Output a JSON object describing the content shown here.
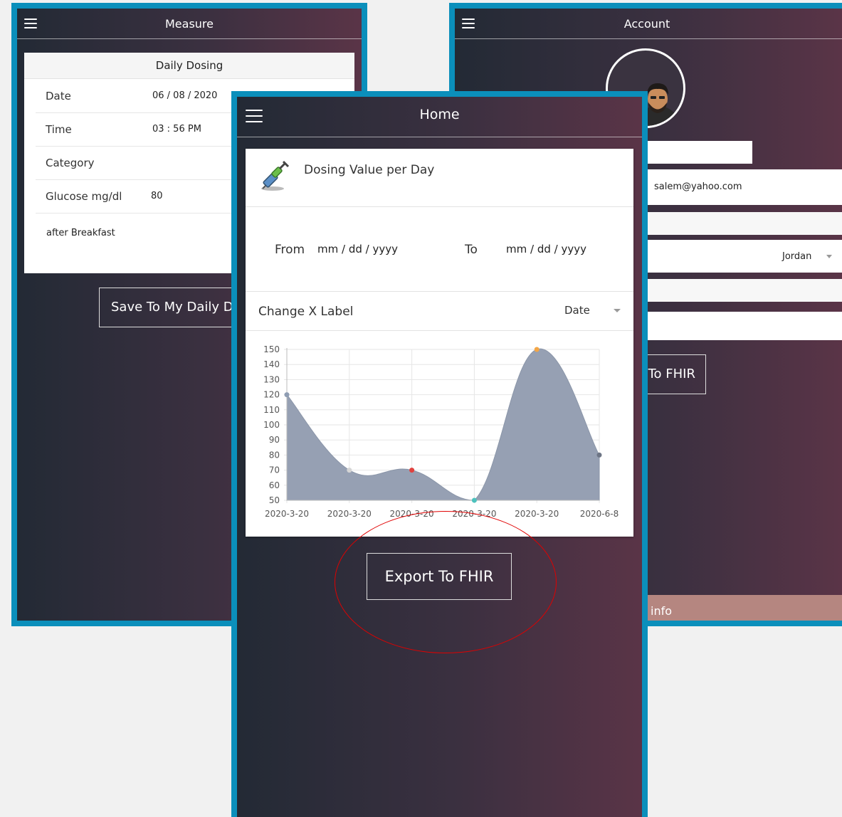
{
  "measure": {
    "title": "Measure",
    "card_title": "Daily Dosing",
    "rows": [
      {
        "label": "Date",
        "value": "06 / 08 / 2020"
      },
      {
        "label": "Time",
        "value": "03 : 56  PM"
      },
      {
        "label": "Category",
        "value": ""
      },
      {
        "label": "Glucose mg/dl",
        "value": "80"
      }
    ],
    "note": "after Breakfast",
    "save_button": "Save To My Daily D"
  },
  "account": {
    "title": "Account",
    "email": "salem@yahoo.com",
    "country": "Jordan",
    "export_button": "To FHIR",
    "info_bar": "info"
  },
  "home": {
    "title": "Home",
    "card_title": "Dosing Value per Day",
    "from_label": "From",
    "from_placeholder": "mm / dd / yyyy",
    "to_label": "To",
    "to_placeholder": "mm / dd / yyyy",
    "x_label_title": "Change X Label",
    "x_label_value": "Date",
    "export_button": "Export To FHIR"
  },
  "chart_data": {
    "type": "area",
    "x": [
      "2020-3-20",
      "2020-3-20",
      "2020-3-20",
      "2020-3-20",
      "2020-3-20",
      "2020-6-8"
    ],
    "series": [
      {
        "values": [
          120,
          70,
          70,
          50,
          150,
          80
        ]
      }
    ],
    "point_colors": [
      "#8f9db3",
      "#d5d5d5",
      "#e0413e",
      "#4dc2bd",
      "#f3a647",
      "#6d7585"
    ],
    "fill_color": "#96a0b3",
    "yticks": [
      50,
      60,
      70,
      80,
      90,
      100,
      110,
      120,
      130,
      140,
      150
    ],
    "ylim": [
      50,
      150
    ],
    "grid": true
  }
}
